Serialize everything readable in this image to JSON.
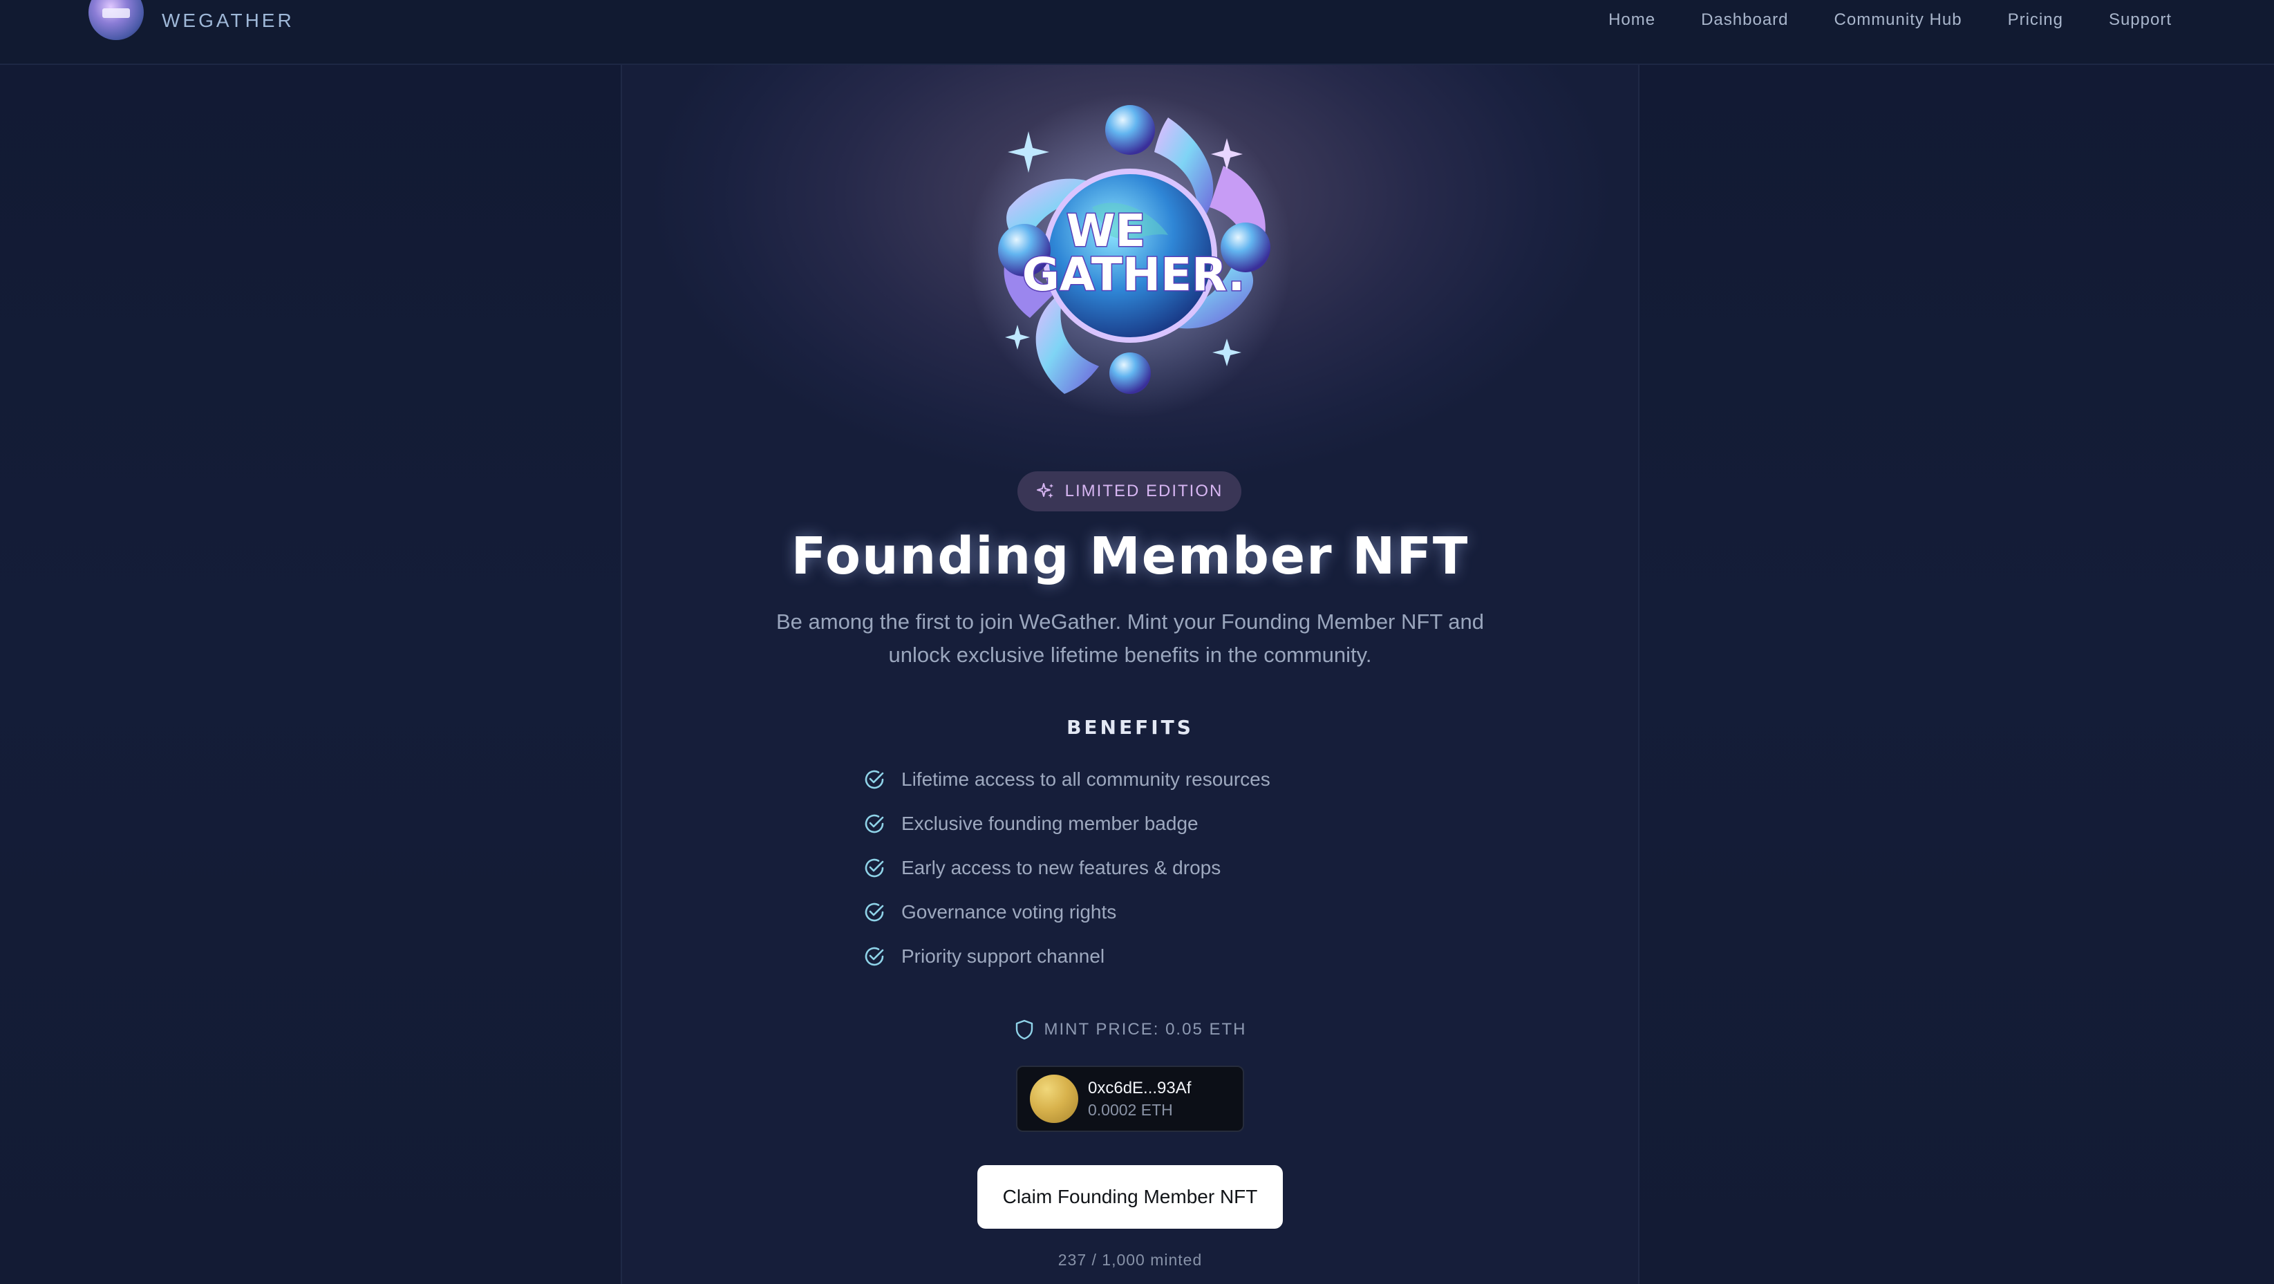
{
  "navbar": {
    "brand": "WEGATHER",
    "links": [
      "Home",
      "Dashboard",
      "Community Hub",
      "Pricing",
      "Support"
    ]
  },
  "hero": {
    "logo_text_1": "WE",
    "logo_text_2": "GATHER."
  },
  "badge": {
    "icon": "sparkles-icon",
    "label": "LIMITED EDITION"
  },
  "title": "Founding Member NFT",
  "description": "Be among the first to join WeGather. Mint your Founding Member NFT and unlock exclusive lifetime benefits in the community.",
  "benefits": {
    "title": "BENEFITS",
    "items": [
      "Lifetime access to all community resources",
      "Exclusive founding member badge",
      "Early access to new features & drops",
      "Governance voting rights",
      "Priority support channel"
    ]
  },
  "mint": {
    "icon": "shield-icon",
    "label": "MINT PRICE: 0.05 ETH"
  },
  "wallet": {
    "address": "0xc6dE...93Af",
    "balance": "0.0002 ETH"
  },
  "claim_button": "Claim Founding Member NFT",
  "minted_status": "237 / 1,000 minted",
  "colors": {
    "accent_check": "#8fd3e8",
    "badge_text": "#d7b6f2",
    "background": "#121b33"
  }
}
